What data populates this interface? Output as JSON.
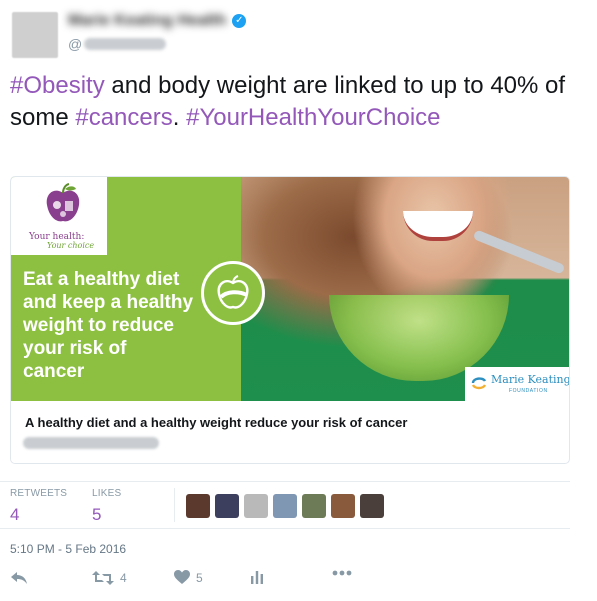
{
  "tweet": {
    "account_name": "Marie Keating Health",
    "handle_prefix": "@",
    "text_parts": [
      {
        "type": "hashtag",
        "text": "#Obesity"
      },
      {
        "type": "text",
        "text": " and body weight are linked to up to 40% of some "
      },
      {
        "type": "hashtag",
        "text": "#cancers"
      },
      {
        "type": "text",
        "text": ". "
      },
      {
        "type": "hashtag",
        "text": "#YourHealthYourChoice"
      }
    ],
    "card": {
      "logo_line1": "Your health:",
      "logo_line2": "Your choice",
      "green_headline": "Eat a healthy diet and keep a healthy weight to reduce your risk of cancer",
      "brand_title": "Marie Keating",
      "brand_sub": "FOUNDATION",
      "title": "A healthy diet and a healthy weight reduce your risk of cancer"
    },
    "stats": {
      "retweets_label": "RETWEETS",
      "retweets_value": "4",
      "likes_label": "LIKES",
      "likes_value": "5"
    },
    "liker_faces": [
      {
        "color": "#5b3a2d"
      },
      {
        "color": "#3d3f5e"
      },
      {
        "color": "#b9b9b9"
      },
      {
        "color": "#7f97b3"
      },
      {
        "color": "#6d7b56"
      },
      {
        "color": "#8a5a3c"
      },
      {
        "color": "#4a3f3a"
      }
    ],
    "timestamp": "5:10 PM - 5 Feb 2016",
    "actions": {
      "retweet_count": "4",
      "like_count": "5"
    },
    "colors": {
      "hashtag": "#9358b9",
      "green_panel": "#8dc041",
      "verified": "#1da1f2",
      "muted": "#8899a6"
    },
    "icons": [
      "verified-badge-icon",
      "reply-icon",
      "retweet-icon",
      "heart-icon",
      "analytics-icon",
      "more-icon"
    ]
  }
}
